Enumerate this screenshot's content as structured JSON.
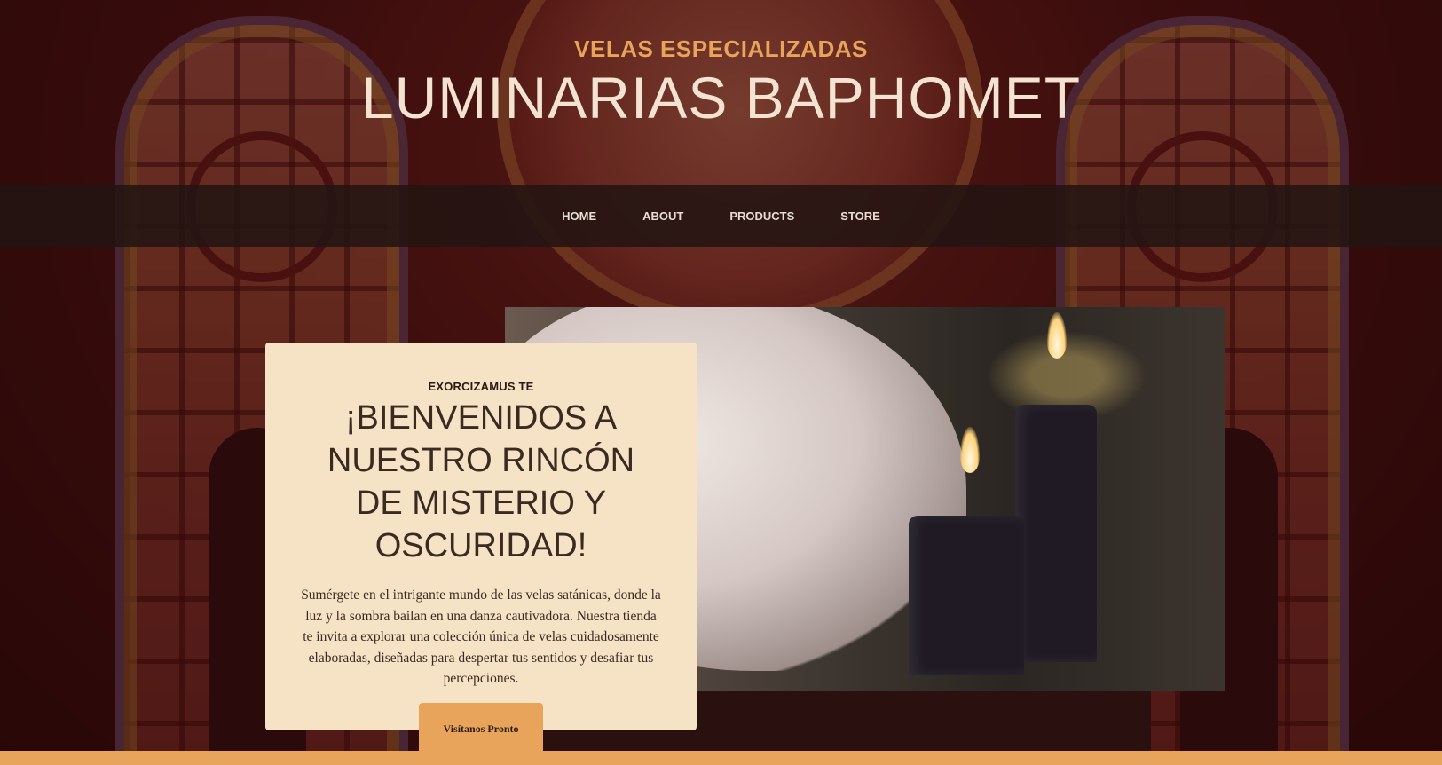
{
  "header": {
    "tagline": "VELAS ESPECIALIZADAS",
    "title": "LUMINARIAS BAPHOMET"
  },
  "nav": {
    "items": [
      {
        "label": "HOME"
      },
      {
        "label": "ABOUT"
      },
      {
        "label": "PRODUCTS"
      },
      {
        "label": "STORE"
      }
    ]
  },
  "intro": {
    "eyebrow": "EXORCIZAMUS TE",
    "heading": "¡BIENVENIDOS A NUESTRO RINCÓN DE MISTERIO Y OSCURIDAD!",
    "body": "Sumérgete en el intrigante mundo de las velas satánicas, donde la luz y la sombra bailan en una danza cautivadora. Nuestra tienda te invita a explorar una colección única de velas cuidadosamente elaboradas, diseñadas para despertar tus sentidos y desafiar tus percepciones.",
    "cta_label": "Visítanos Pronto"
  },
  "colors": {
    "accent": "#e8a45a",
    "card_bg": "#f6e3c6",
    "nav_bg": "#231412",
    "title_text": "#f3e3d0"
  }
}
